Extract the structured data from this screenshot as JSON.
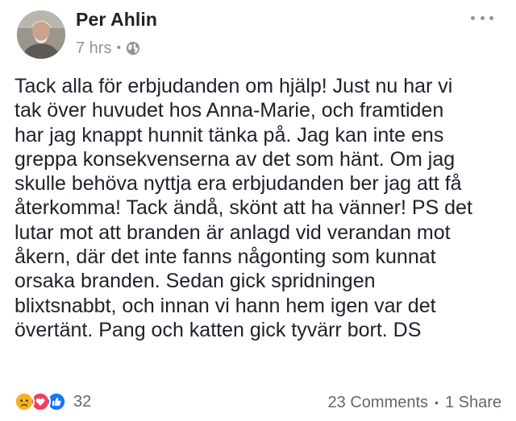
{
  "post": {
    "author": "Per Ahlin",
    "time": "7 hrs",
    "separator": "•",
    "audience_icon": "globe-icon",
    "body": "Tack alla för erbjudanden om hjälp! Just nu har vi\ntak över huvudet hos Anna-Marie, och framtiden\nhar jag knappt hunnit tänka på. Jag kan inte ens\ngreppa konsekvenserna av det som hänt. Om jag\nskulle behöva nyttja era erbjudanden ber jag att få\nåterkomma! Tack ändå, skönt att ha vänner! PS det\nlutar mot att branden är anlagd vid verandan mot\nåkern, där det inte fanns någonting som kunnat\norsaka branden. Sedan gick spridningen\nblixtsnabbt, och innan vi hann hem igen var det\növertänt. Pang och katten gick tyvärr bort. DS"
  },
  "footer": {
    "reaction_icons": [
      "sad-icon",
      "love-icon",
      "like-icon"
    ],
    "reaction_count": "32",
    "comments": "23 Comments",
    "dot": "•",
    "shares": "1 Share"
  },
  "colors": {
    "text": "#1d2129",
    "secondary": "#90949c",
    "footer_text": "#606770",
    "like_blue": "#1877f2",
    "love_red": "#f33e58",
    "sad_yellow": "#f7b125"
  }
}
